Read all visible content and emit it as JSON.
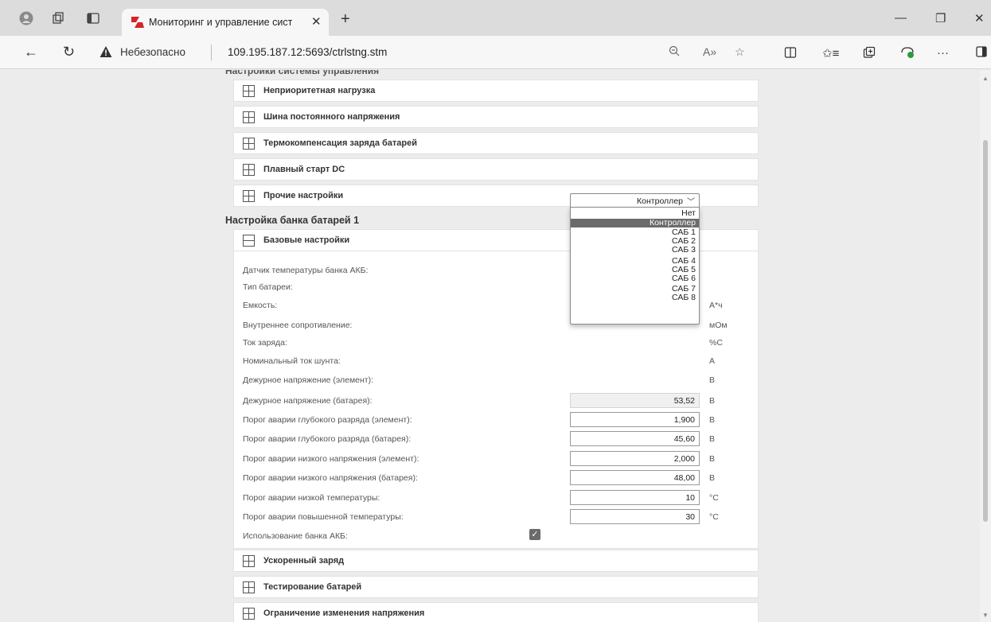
{
  "browser": {
    "tab_title": "Мониторинг и управление сист",
    "tab_close": "✕",
    "new_tab": "+",
    "security_warning": "Небезопасно",
    "url": "109.195.187.12:5693/ctrlstng.stm",
    "window_controls": {
      "minimize": "—",
      "restore": "❐",
      "close": "✕"
    },
    "more_label": "···"
  },
  "page": {
    "cut_heading": "Настройки системы управления",
    "top_panels": [
      "Неприоритетная нагрузка",
      "Шина постоянного напряжения",
      "Термокомпенсация заряда батарей",
      "Плавный старт DC",
      "Прочие настройки"
    ],
    "section_title": "Настройка банка батарей 1",
    "expanded_panel": "Базовые настройки",
    "temp_sensor": {
      "label": "Датчик температуры банка АКБ:",
      "value": "Контроллер",
      "options": [
        "Нет",
        "Контроллер",
        "САБ 1",
        "САБ 2",
        "САБ 3",
        "САБ 4",
        "САБ 5",
        "САБ 6",
        "САБ 7",
        "САБ 8"
      ],
      "selected_index": 1
    },
    "rows": [
      {
        "label": "Тип батареи:",
        "value": "",
        "unit": ""
      },
      {
        "label": "Емкость:",
        "value": "",
        "unit": "А*ч"
      },
      {
        "label": "Внутреннее сопротивление:",
        "value": "",
        "unit": "мОм"
      },
      {
        "label": "Ток заряда:",
        "value": "",
        "unit": "%C"
      },
      {
        "label": "Номинальный ток шунта:",
        "value": "",
        "unit": "А"
      },
      {
        "label": "Дежурное напряжение (элемент):",
        "value": "",
        "unit": "В"
      },
      {
        "label": "Дежурное напряжение (батарея):",
        "value": "53,52",
        "unit": "В"
      },
      {
        "label": "Порог аварии глубокого разряда (элемент):",
        "value": "1,900",
        "unit": "В"
      },
      {
        "label": "Порог аварии глубокого разряда (батарея):",
        "value": "45,60",
        "unit": "В"
      },
      {
        "label": "Порог аварии низкого напряжения (элемент):",
        "value": "2,000",
        "unit": "В"
      },
      {
        "label": "Порог аварии низкого напряжения (батарея):",
        "value": "48,00",
        "unit": "В"
      },
      {
        "label": "Порог аварии низкой температуры:",
        "value": "10",
        "unit": "°C"
      },
      {
        "label": "Порог аварии повышенной температуры:",
        "value": "30",
        "unit": "°C"
      }
    ],
    "bank_use": {
      "label": "Использование банка АКБ:",
      "checked": true,
      "check_glyph": "✓"
    },
    "bottom_panels": [
      "Ускоренный заряд",
      "Тестирование батарей",
      "Ограничение изменения напряжения"
    ]
  },
  "colors": {
    "selected_option": "#6b6b6b",
    "logo_red": "#d6232a"
  }
}
